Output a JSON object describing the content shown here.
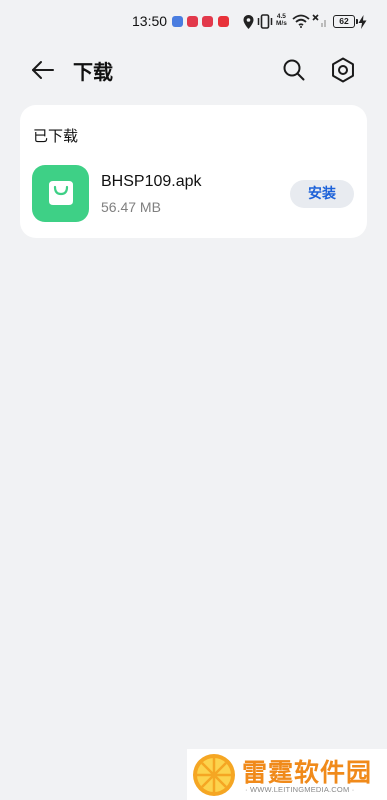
{
  "status_bar": {
    "time": "13:50",
    "net_speed_value": "4.5",
    "net_speed_unit": "M/s",
    "battery": "62"
  },
  "app_bar": {
    "title": "下载"
  },
  "downloads": {
    "section_label": "已下载",
    "items": [
      {
        "file_name": "BHSP109.apk",
        "file_size": "56.47 MB",
        "action_label": "安装",
        "icon": "shopping-bag-icon"
      }
    ]
  },
  "watermark": {
    "brand": "雷霆软件园",
    "url": "WWW.LEITINGMEDIA.COM"
  },
  "colors": {
    "background": "#f1f2f4",
    "card": "#ffffff",
    "app_icon": "#3ed086",
    "accent": "#1d62d9",
    "watermark_orange": "#f08a1a"
  }
}
